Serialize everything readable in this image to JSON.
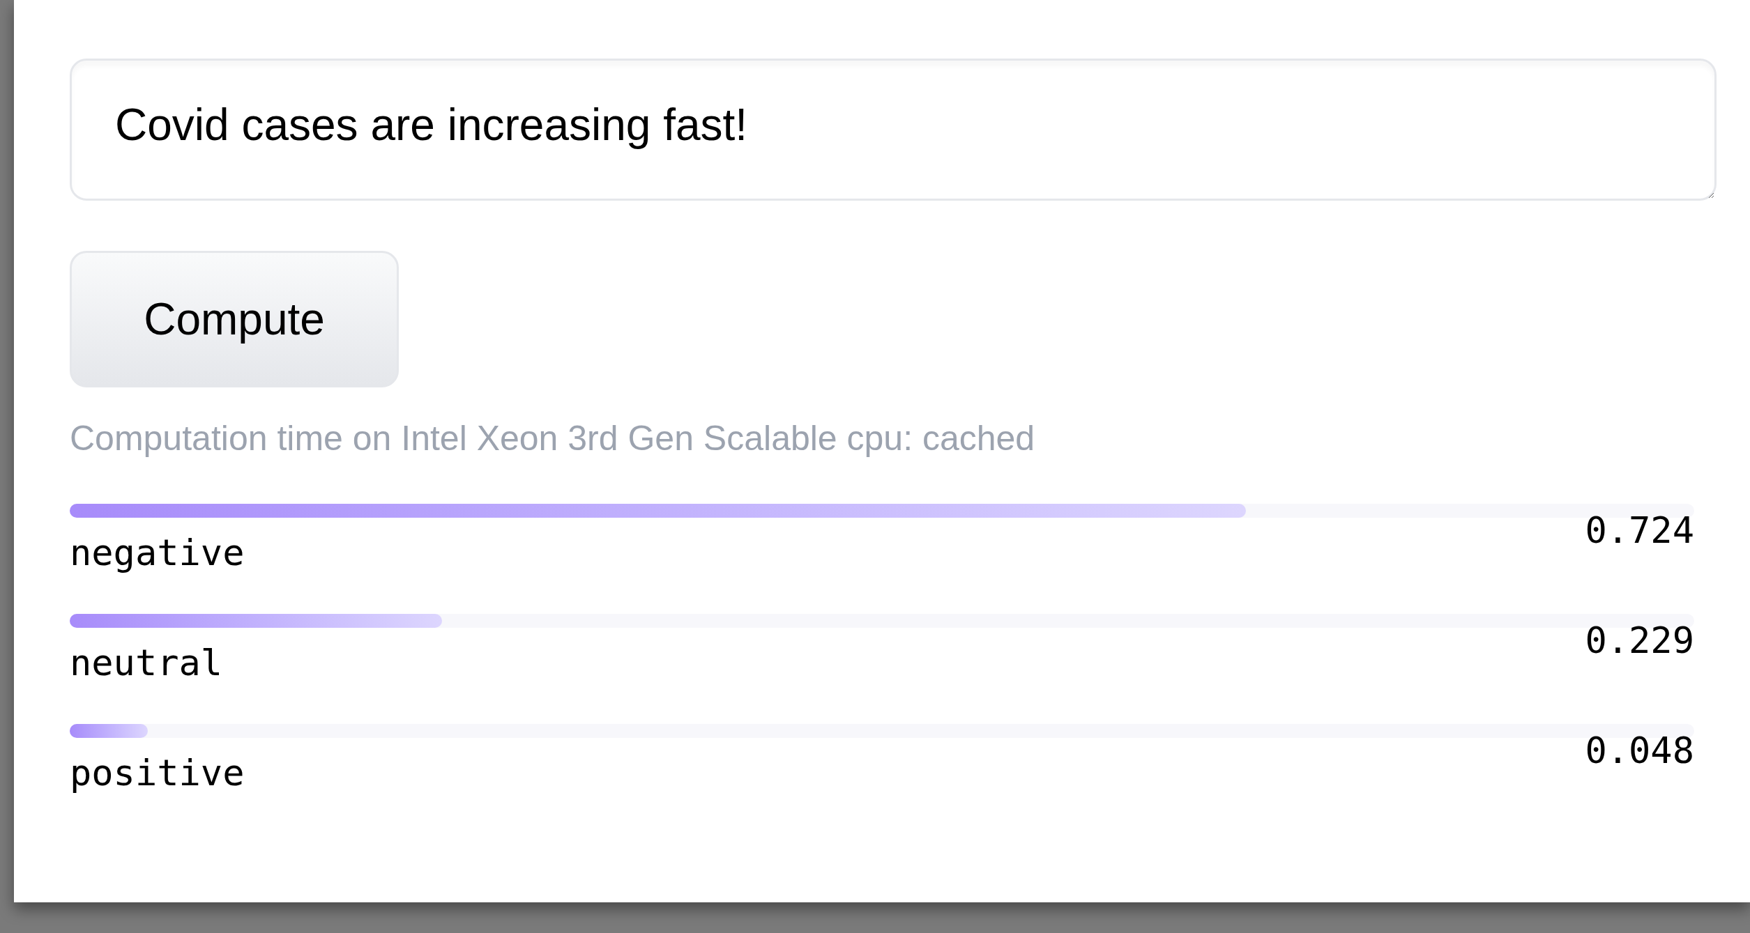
{
  "input": {
    "value": "Covid cases are increasing fast!"
  },
  "button": {
    "label": "Compute"
  },
  "caption": "Computation time on Intel Xeon 3rd Gen Scalable cpu: cached",
  "labels": [
    {
      "name": "negative",
      "level": 0.724,
      "reading": "0.724"
    },
    {
      "name": "neutral",
      "level": 0.229,
      "reading": "0.229"
    },
    {
      "name": "positive",
      "level": 0.048,
      "reading": "0.048"
    }
  ]
}
